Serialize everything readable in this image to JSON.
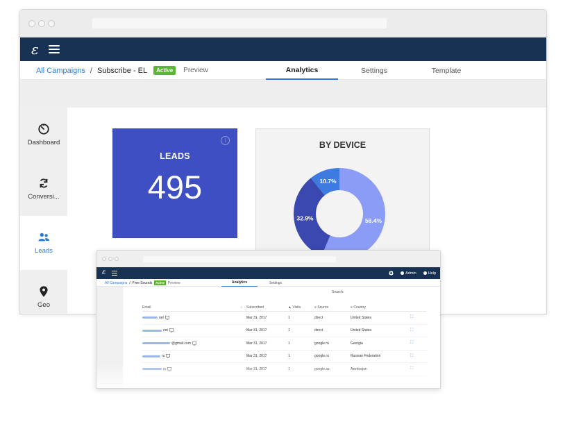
{
  "app": {
    "logo": "ε",
    "colors": {
      "appbar": "#173153",
      "accent": "#2f7bd6",
      "leads_card": "#3d4fc3",
      "active_badge": "#5cb536"
    }
  },
  "breadcrumb": {
    "root": "All Campaigns",
    "separator": "/",
    "current": "Subscribe - EL",
    "status": "Active",
    "preview": "Preview"
  },
  "tabs": [
    {
      "label": "Analytics",
      "active": true
    },
    {
      "label": "Settings",
      "active": false
    },
    {
      "label": "Template",
      "active": false
    }
  ],
  "sidebar": {
    "items": [
      {
        "label": "Dashboard",
        "icon": "dashboard-icon",
        "active": false
      },
      {
        "label": "Conversi...",
        "icon": "refresh-icon",
        "active": false
      },
      {
        "label": "Leads",
        "icon": "users-icon",
        "active": true
      },
      {
        "label": "Geo",
        "icon": "map-pin-icon",
        "active": false
      }
    ]
  },
  "leads_card": {
    "title": "LEADS",
    "value": "495",
    "info": "i"
  },
  "device_card": {
    "title": "BY DEVICE",
    "chart_data": {
      "type": "pie",
      "title": "BY DEVICE",
      "slices": [
        {
          "label": "56.4%",
          "value": 56.4,
          "color": "#8a9cf5"
        },
        {
          "label": "32.9%",
          "value": 32.9,
          "color": "#3a48b0"
        },
        {
          "label": "10.7%",
          "value": 10.7,
          "color": "#3e7be0"
        }
      ]
    }
  },
  "overlay": {
    "logo": "ε",
    "admin": "Admin",
    "help": "Help",
    "breadcrumb": {
      "root": "All Campaigns",
      "separator": "/",
      "current": "Free Sounds",
      "status": "Active",
      "preview": "Preview"
    },
    "tabs": [
      {
        "label": "Analytics",
        "active": true
      },
      {
        "label": "Settings",
        "active": false
      }
    ],
    "search_label": "Search:",
    "table": {
      "columns": [
        "Email",
        "Subscribed",
        "Visits",
        "Source",
        "Country"
      ],
      "rows": [
        {
          "email": "net",
          "subscribed": "Mar 31, 2017",
          "visits": "1",
          "source": "direct",
          "country": "United States"
        },
        {
          "email": "net",
          "subscribed": "Mar 31, 2017",
          "visits": "1",
          "source": "direct",
          "country": "United States"
        },
        {
          "email": "@gmail.com",
          "subscribed": "Mar 31, 2017",
          "visits": "1",
          "source": "google.ru",
          "country": "Georgia"
        },
        {
          "email": "ru",
          "subscribed": "Mar 31, 2017",
          "visits": "1",
          "source": "google.ru",
          "country": "Russian Federation"
        },
        {
          "email": "ru",
          "subscribed": "Mar 31, 2017",
          "visits": "1",
          "source": "google.az",
          "country": "Azerbaijan"
        }
      ]
    }
  }
}
